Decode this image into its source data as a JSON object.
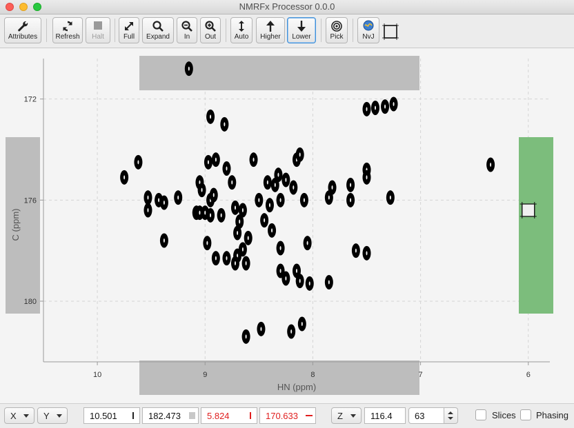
{
  "window": {
    "title": "NMRFx Processor 0.0.0"
  },
  "toolbar": {
    "attributes": "Attributes",
    "refresh": "Refresh",
    "halt": "Halt",
    "full": "Full",
    "expand": "Expand",
    "zoom_in": "In",
    "zoom_out": "Out",
    "auto": "Auto",
    "higher": "Higher",
    "lower": "Lower",
    "pick": "Pick",
    "nvj": "NvJ"
  },
  "spectrum": {
    "x_axis_label": "HN (ppm)",
    "y_axis_label": "C (ppm)",
    "x_ticks": [
      "10",
      "9",
      "8",
      "7",
      "6"
    ],
    "y_ticks": [
      "172",
      "176",
      "180"
    ],
    "x_range_ppm": [
      10.5,
      5.8
    ],
    "y_range_ppm": [
      170.4,
      182.4
    ],
    "slice_color": "#7cbd7c",
    "projection_color": "#bdbdbd",
    "peak_color": "#000000",
    "peaks": [
      [
        9.15,
        170.8
      ],
      [
        8.95,
        172.7
      ],
      [
        8.82,
        173.0
      ],
      [
        7.25,
        172.2
      ],
      [
        7.33,
        172.3
      ],
      [
        7.42,
        172.35
      ],
      [
        7.5,
        172.4
      ],
      [
        9.62,
        174.5
      ],
      [
        9.75,
        175.1
      ],
      [
        9.53,
        175.9
      ],
      [
        9.53,
        176.4
      ],
      [
        9.43,
        176.0
      ],
      [
        9.38,
        176.1
      ],
      [
        9.25,
        175.9
      ],
      [
        9.05,
        175.3
      ],
      [
        9.03,
        175.6
      ],
      [
        9.08,
        176.5
      ],
      [
        8.95,
        176.0
      ],
      [
        8.92,
        175.8
      ],
      [
        8.97,
        174.5
      ],
      [
        8.9,
        174.4
      ],
      [
        8.8,
        174.75
      ],
      [
        8.75,
        175.3
      ],
      [
        9.05,
        176.5
      ],
      [
        9.0,
        176.5
      ],
      [
        8.95,
        176.6
      ],
      [
        8.85,
        176.6
      ],
      [
        8.72,
        176.3
      ],
      [
        8.65,
        176.4
      ],
      [
        8.68,
        176.85
      ],
      [
        8.7,
        177.3
      ],
      [
        8.6,
        177.5
      ],
      [
        8.5,
        176.0
      ],
      [
        8.4,
        176.2
      ],
      [
        8.45,
        176.8
      ],
      [
        8.38,
        177.2
      ],
      [
        8.3,
        176.0
      ],
      [
        8.42,
        175.3
      ],
      [
        8.55,
        174.4
      ],
      [
        8.32,
        175.0
      ],
      [
        8.35,
        175.4
      ],
      [
        8.25,
        175.2
      ],
      [
        8.18,
        175.5
      ],
      [
        8.15,
        174.4
      ],
      [
        8.12,
        174.2
      ],
      [
        8.08,
        176.0
      ],
      [
        7.85,
        175.9
      ],
      [
        7.82,
        175.5
      ],
      [
        7.65,
        175.4
      ],
      [
        7.65,
        176.0
      ],
      [
        7.5,
        174.8
      ],
      [
        7.5,
        175.1
      ],
      [
        7.28,
        175.9
      ],
      [
        8.05,
        177.7
      ],
      [
        7.6,
        178.0
      ],
      [
        7.5,
        178.1
      ],
      [
        8.98,
        177.7
      ],
      [
        8.9,
        178.3
      ],
      [
        8.7,
        178.2
      ],
      [
        8.65,
        177.95
      ],
      [
        8.72,
        178.5
      ],
      [
        8.8,
        178.3
      ],
      [
        9.38,
        177.6
      ],
      [
        8.62,
        178.5
      ],
      [
        8.3,
        177.9
      ],
      [
        8.3,
        178.8
      ],
      [
        8.25,
        179.1
      ],
      [
        8.15,
        178.8
      ],
      [
        8.12,
        179.2
      ],
      [
        8.03,
        179.3
      ],
      [
        7.85,
        179.25
      ],
      [
        8.62,
        181.4
      ],
      [
        8.48,
        181.1
      ],
      [
        8.2,
        181.2
      ],
      [
        8.1,
        180.9
      ],
      [
        6.35,
        174.6
      ]
    ],
    "cursor": {
      "hn": 6.0,
      "c": 176.4
    }
  },
  "status": {
    "x_axis_select": "X",
    "y_axis_select": "Y",
    "x_value": "10.501",
    "y_value": "182.473",
    "x_delta": "5.824",
    "y_delta": "170.633",
    "z_axis_select": "Z",
    "z_value": "116.4",
    "plane": "63",
    "slices_label": "Slices",
    "phasing_label": "Phasing"
  }
}
